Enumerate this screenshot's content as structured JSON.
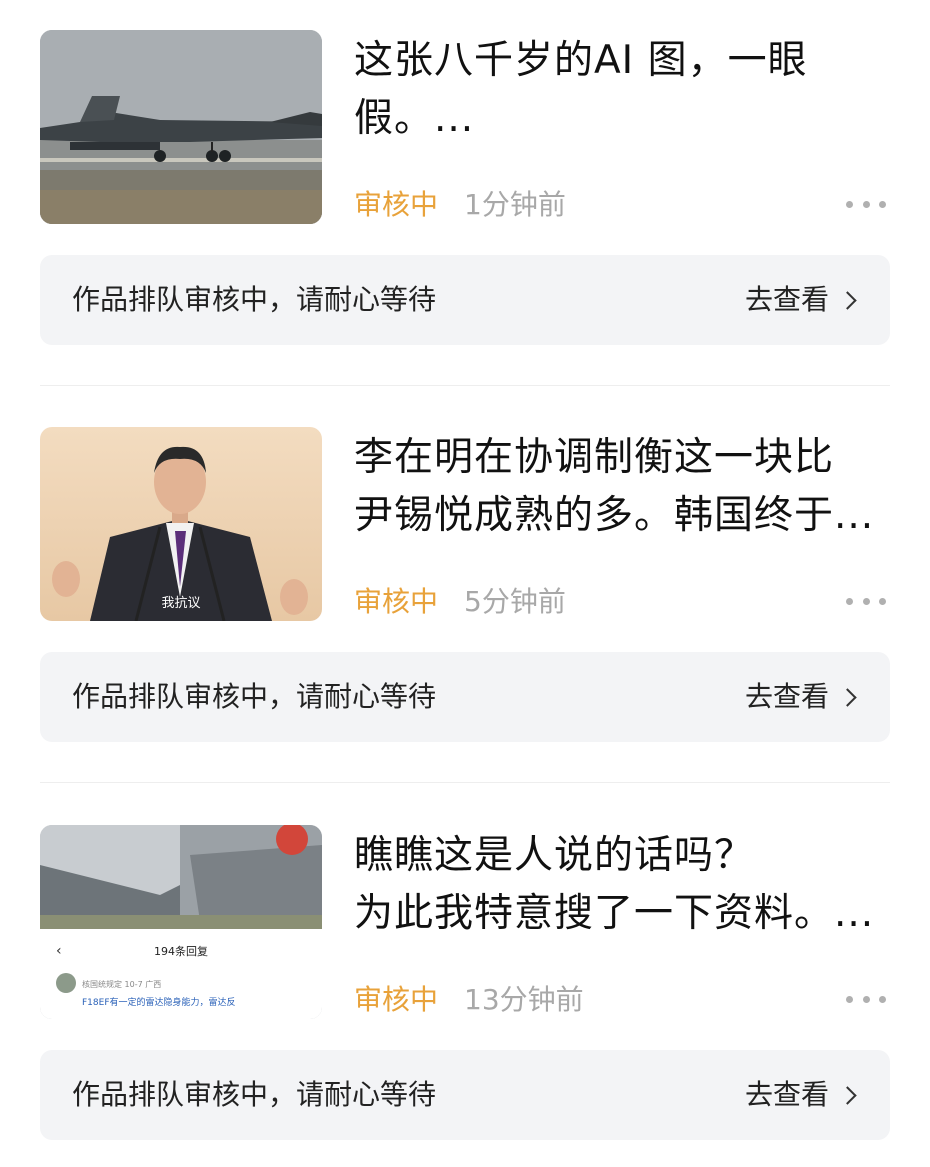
{
  "posts": [
    {
      "title_lines": [
        "这张八千岁的AI 图，一眼",
        "假。..."
      ],
      "status": "审核中",
      "time": "1分钟前",
      "notice": "作品排队审核中，请耐心等待",
      "link": "去查看",
      "thumb": "jet-on-runway"
    },
    {
      "title_lines": [
        "李在明在协调制衡这一块比",
        "尹锡悦成熟的多。韩国终于..."
      ],
      "status": "审核中",
      "time": "5分钟前",
      "notice": "作品排队审核中，请耐心等待",
      "link": "去查看",
      "thumb": "man-speaking-at-podium",
      "thumb_caption": "我抗议"
    },
    {
      "title_lines": [
        "瞧瞧这是人说的话吗？",
        "为此我特意搜了一下资料。..."
      ],
      "status": "审核中",
      "time": "13分钟前",
      "notice": "作品排队审核中，请耐心等待",
      "link": "去查看",
      "thumb": "jet-screenshot-with-comments",
      "thumb_header": "194条回复",
      "thumb_user": "核国统规定 10-7 广西",
      "thumb_comment": "F18EF有一定的雷达隐身能力，雷达反"
    }
  ],
  "colors": {
    "status": "#e8a23a",
    "time": "#a8a8a8",
    "notice_bg": "#f3f4f6"
  }
}
